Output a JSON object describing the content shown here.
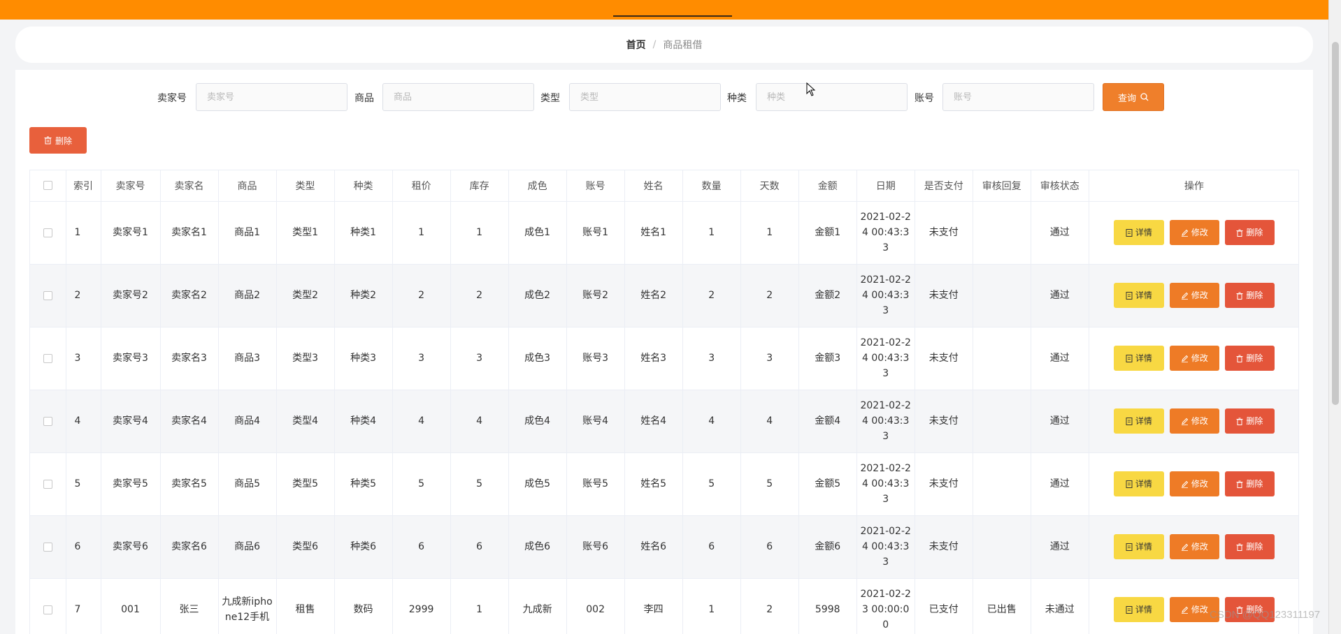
{
  "breadcrumb": {
    "home": "首页",
    "separator": "/",
    "current": "商品租借"
  },
  "search": {
    "seller_no_label": "卖家号",
    "seller_no_placeholder": "卖家号",
    "product_label": "商品",
    "product_placeholder": "商品",
    "type_label": "类型",
    "type_placeholder": "类型",
    "category_label": "种类",
    "category_placeholder": "种类",
    "account_label": "账号",
    "account_placeholder": "账号",
    "query_label": "查询"
  },
  "toolbar": {
    "delete_label": "删除"
  },
  "table": {
    "headers": [
      "索引",
      "卖家号",
      "卖家名",
      "商品",
      "类型",
      "种类",
      "租价",
      "库存",
      "成色",
      "账号",
      "姓名",
      "数量",
      "天数",
      "金额",
      "日期",
      "是否支付",
      "审核回复",
      "审核状态",
      "操作"
    ],
    "actions": {
      "detail": "详情",
      "edit": "修改",
      "delete": "删除"
    },
    "rows": [
      {
        "index": "1",
        "seller_no": "卖家号1",
        "seller_name": "卖家名1",
        "product": "商品1",
        "type": "类型1",
        "category": "种类1",
        "rent": "1",
        "stock": "1",
        "condition": "成色1",
        "account": "账号1",
        "name": "姓名1",
        "qty": "1",
        "days": "1",
        "amount": "金额1",
        "date": "2021-02-24 00:43:33",
        "paid": "未支付",
        "reply": "",
        "status": "通过"
      },
      {
        "index": "2",
        "seller_no": "卖家号2",
        "seller_name": "卖家名2",
        "product": "商品2",
        "type": "类型2",
        "category": "种类2",
        "rent": "2",
        "stock": "2",
        "condition": "成色2",
        "account": "账号2",
        "name": "姓名2",
        "qty": "2",
        "days": "2",
        "amount": "金额2",
        "date": "2021-02-24 00:43:33",
        "paid": "未支付",
        "reply": "",
        "status": "通过"
      },
      {
        "index": "3",
        "seller_no": "卖家号3",
        "seller_name": "卖家名3",
        "product": "商品3",
        "type": "类型3",
        "category": "种类3",
        "rent": "3",
        "stock": "3",
        "condition": "成色3",
        "account": "账号3",
        "name": "姓名3",
        "qty": "3",
        "days": "3",
        "amount": "金额3",
        "date": "2021-02-24 00:43:33",
        "paid": "未支付",
        "reply": "",
        "status": "通过"
      },
      {
        "index": "4",
        "seller_no": "卖家号4",
        "seller_name": "卖家名4",
        "product": "商品4",
        "type": "类型4",
        "category": "种类4",
        "rent": "4",
        "stock": "4",
        "condition": "成色4",
        "account": "账号4",
        "name": "姓名4",
        "qty": "4",
        "days": "4",
        "amount": "金额4",
        "date": "2021-02-24 00:43:33",
        "paid": "未支付",
        "reply": "",
        "status": "通过"
      },
      {
        "index": "5",
        "seller_no": "卖家号5",
        "seller_name": "卖家名5",
        "product": "商品5",
        "type": "类型5",
        "category": "种类5",
        "rent": "5",
        "stock": "5",
        "condition": "成色5",
        "account": "账号5",
        "name": "姓名5",
        "qty": "5",
        "days": "5",
        "amount": "金额5",
        "date": "2021-02-24 00:43:33",
        "paid": "未支付",
        "reply": "",
        "status": "通过"
      },
      {
        "index": "6",
        "seller_no": "卖家号6",
        "seller_name": "卖家名6",
        "product": "商品6",
        "type": "类型6",
        "category": "种类6",
        "rent": "6",
        "stock": "6",
        "condition": "成色6",
        "account": "账号6",
        "name": "姓名6",
        "qty": "6",
        "days": "6",
        "amount": "金额6",
        "date": "2021-02-24 00:43:33",
        "paid": "未支付",
        "reply": "",
        "status": "通过"
      },
      {
        "index": "7",
        "seller_no": "001",
        "seller_name": "张三",
        "product": "九成新iphone12手机",
        "type": "租售",
        "category": "数码",
        "rent": "2999",
        "stock": "1",
        "condition": "九成新",
        "account": "002",
        "name": "李四",
        "qty": "1",
        "days": "2",
        "amount": "5998",
        "date": "2021-02-23 00:00:00",
        "paid": "已支付",
        "reply": "已出售",
        "status": "未通过"
      }
    ]
  },
  "watermark": "CSDN @QQ123311197",
  "colors": {
    "topbar": "#ff8c00",
    "query_button": "#ef7f2b",
    "delete_button": "#e4553a",
    "detail_button": "#f8d843",
    "edit_button": "#ee7b26",
    "row_stripe": "#f5f6f8"
  }
}
